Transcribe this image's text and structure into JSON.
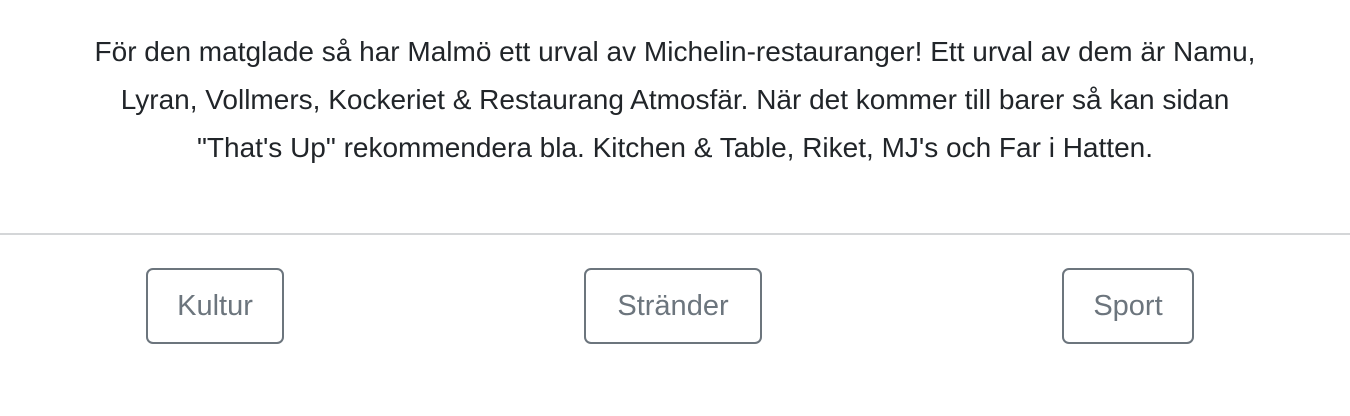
{
  "intro": {
    "line1": "För den matglade så har Malmö ett urval av Michelin-restauranger! Ett urval av dem är Namu,",
    "line2": "Lyran, Vollmers, Kockeriet & Restaurang Atmosfär. När det kommer till barer så kan sidan",
    "line3": "\"That's Up\" rekommendera bla. Kitchen & Table, Riket, MJ's och Far i Hatten."
  },
  "buttons": {
    "kultur": "Kultur",
    "strander": "Stränder",
    "sport": "Sport"
  },
  "colors": {
    "text": "#212529",
    "button_outline": "#6c757d",
    "divider": "#d4d6d8",
    "background": "#ffffff"
  }
}
